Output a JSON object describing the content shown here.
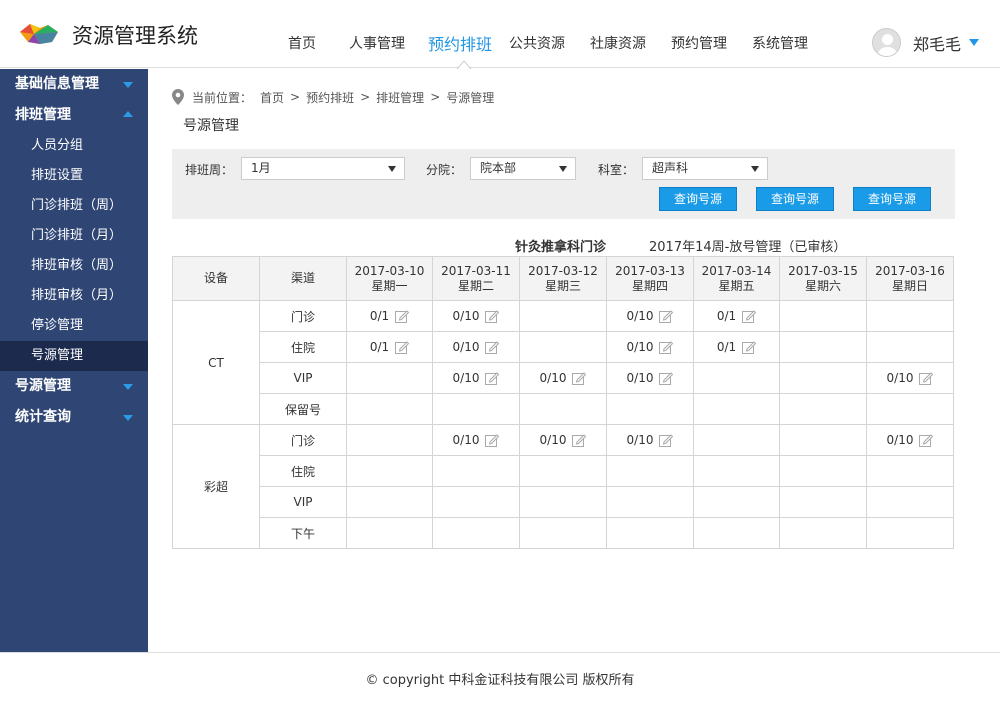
{
  "app": {
    "title": "资源管理系统",
    "logo": "colorful-logo"
  },
  "nav": {
    "items": [
      {
        "label": "首页",
        "active": false
      },
      {
        "label": "人事管理",
        "active": false
      },
      {
        "label": "预约排班",
        "active": true
      },
      {
        "label": "公共资源",
        "active": false
      },
      {
        "label": "社康资源",
        "active": false
      },
      {
        "label": "预约管理",
        "active": false
      },
      {
        "label": "系统管理",
        "active": false
      }
    ]
  },
  "user": {
    "name": "郑毛毛",
    "icon": "user-avatar-icon"
  },
  "sidebar": {
    "groups": [
      {
        "label": "基础信息管理",
        "expanded": false
      },
      {
        "label": "排班管理",
        "expanded": true,
        "items": [
          "人员分组",
          "排班设置",
          "门诊排班（周）",
          "门诊排班（月）",
          "排班审核（周）",
          "排班审核（月）",
          "停诊管理",
          "号源管理"
        ],
        "active_item": "号源管理"
      },
      {
        "label": "号源管理",
        "expanded": false
      },
      {
        "label": "统计查询",
        "expanded": false
      }
    ]
  },
  "breadcrumb": {
    "prefix": "当前位置：",
    "items": [
      "首页",
      "预约排班",
      "排班管理",
      "号源管理"
    ],
    "sep": ">"
  },
  "page_title": "号源管理",
  "filter": {
    "week_label": "排班周：",
    "week_value": "1月",
    "branch_label": "分院：",
    "branch_value": "院本部",
    "dept_label": "科室：",
    "dept_value": "超声科",
    "buttons": [
      "查询号源",
      "查询号源",
      "查询号源"
    ]
  },
  "table_caption": {
    "dept": "针灸推拿科门诊",
    "week": "2017年14周-放号管理（已审核）"
  },
  "table": {
    "col_device": "设备",
    "col_channel": "渠道",
    "dates": [
      {
        "date": "2017-03-10",
        "weekday": "星期一"
      },
      {
        "date": "2017-03-11",
        "weekday": "星期二"
      },
      {
        "date": "2017-03-12",
        "weekday": "星期三"
      },
      {
        "date": "2017-03-13",
        "weekday": "星期四"
      },
      {
        "date": "2017-03-14",
        "weekday": "星期五"
      },
      {
        "date": "2017-03-15",
        "weekday": "星期六"
      },
      {
        "date": "2017-03-16",
        "weekday": "星期日"
      }
    ],
    "groups": [
      {
        "device": "CT",
        "rows": [
          {
            "channel": "门诊",
            "cells": [
              "0/1",
              "0/10",
              "",
              "0/10",
              "0/1",
              "",
              ""
            ]
          },
          {
            "channel": "住院",
            "cells": [
              "0/1",
              "0/10",
              "",
              "0/10",
              "0/1",
              "",
              ""
            ]
          },
          {
            "channel": "VIP",
            "cells": [
              "",
              "0/10",
              "0/10",
              "0/10",
              "",
              "",
              "0/10"
            ]
          },
          {
            "channel": "保留号",
            "cells": [
              "",
              "",
              "",
              "",
              "",
              "",
              ""
            ]
          }
        ]
      },
      {
        "device": "彩超",
        "rows": [
          {
            "channel": "门诊",
            "cells": [
              "",
              "0/10",
              "0/10",
              "0/10",
              "",
              "",
              "0/10"
            ]
          },
          {
            "channel": "住院",
            "cells": [
              "",
              "",
              "",
              "",
              "",
              "",
              ""
            ]
          },
          {
            "channel": "VIP",
            "cells": [
              "",
              "",
              "",
              "",
              "",
              "",
              ""
            ]
          },
          {
            "channel": "下午",
            "cells": [
              "",
              "",
              "",
              "",
              "",
              "",
              ""
            ]
          }
        ]
      }
    ]
  },
  "footer": {
    "text": "© copyright 中科金证科技有限公司 版权所有"
  },
  "colors": {
    "accent": "#2196e4",
    "sidebar_bg": "#2f4675",
    "sidebar_active": "#1c2b4d",
    "button": "#1a9be8"
  }
}
